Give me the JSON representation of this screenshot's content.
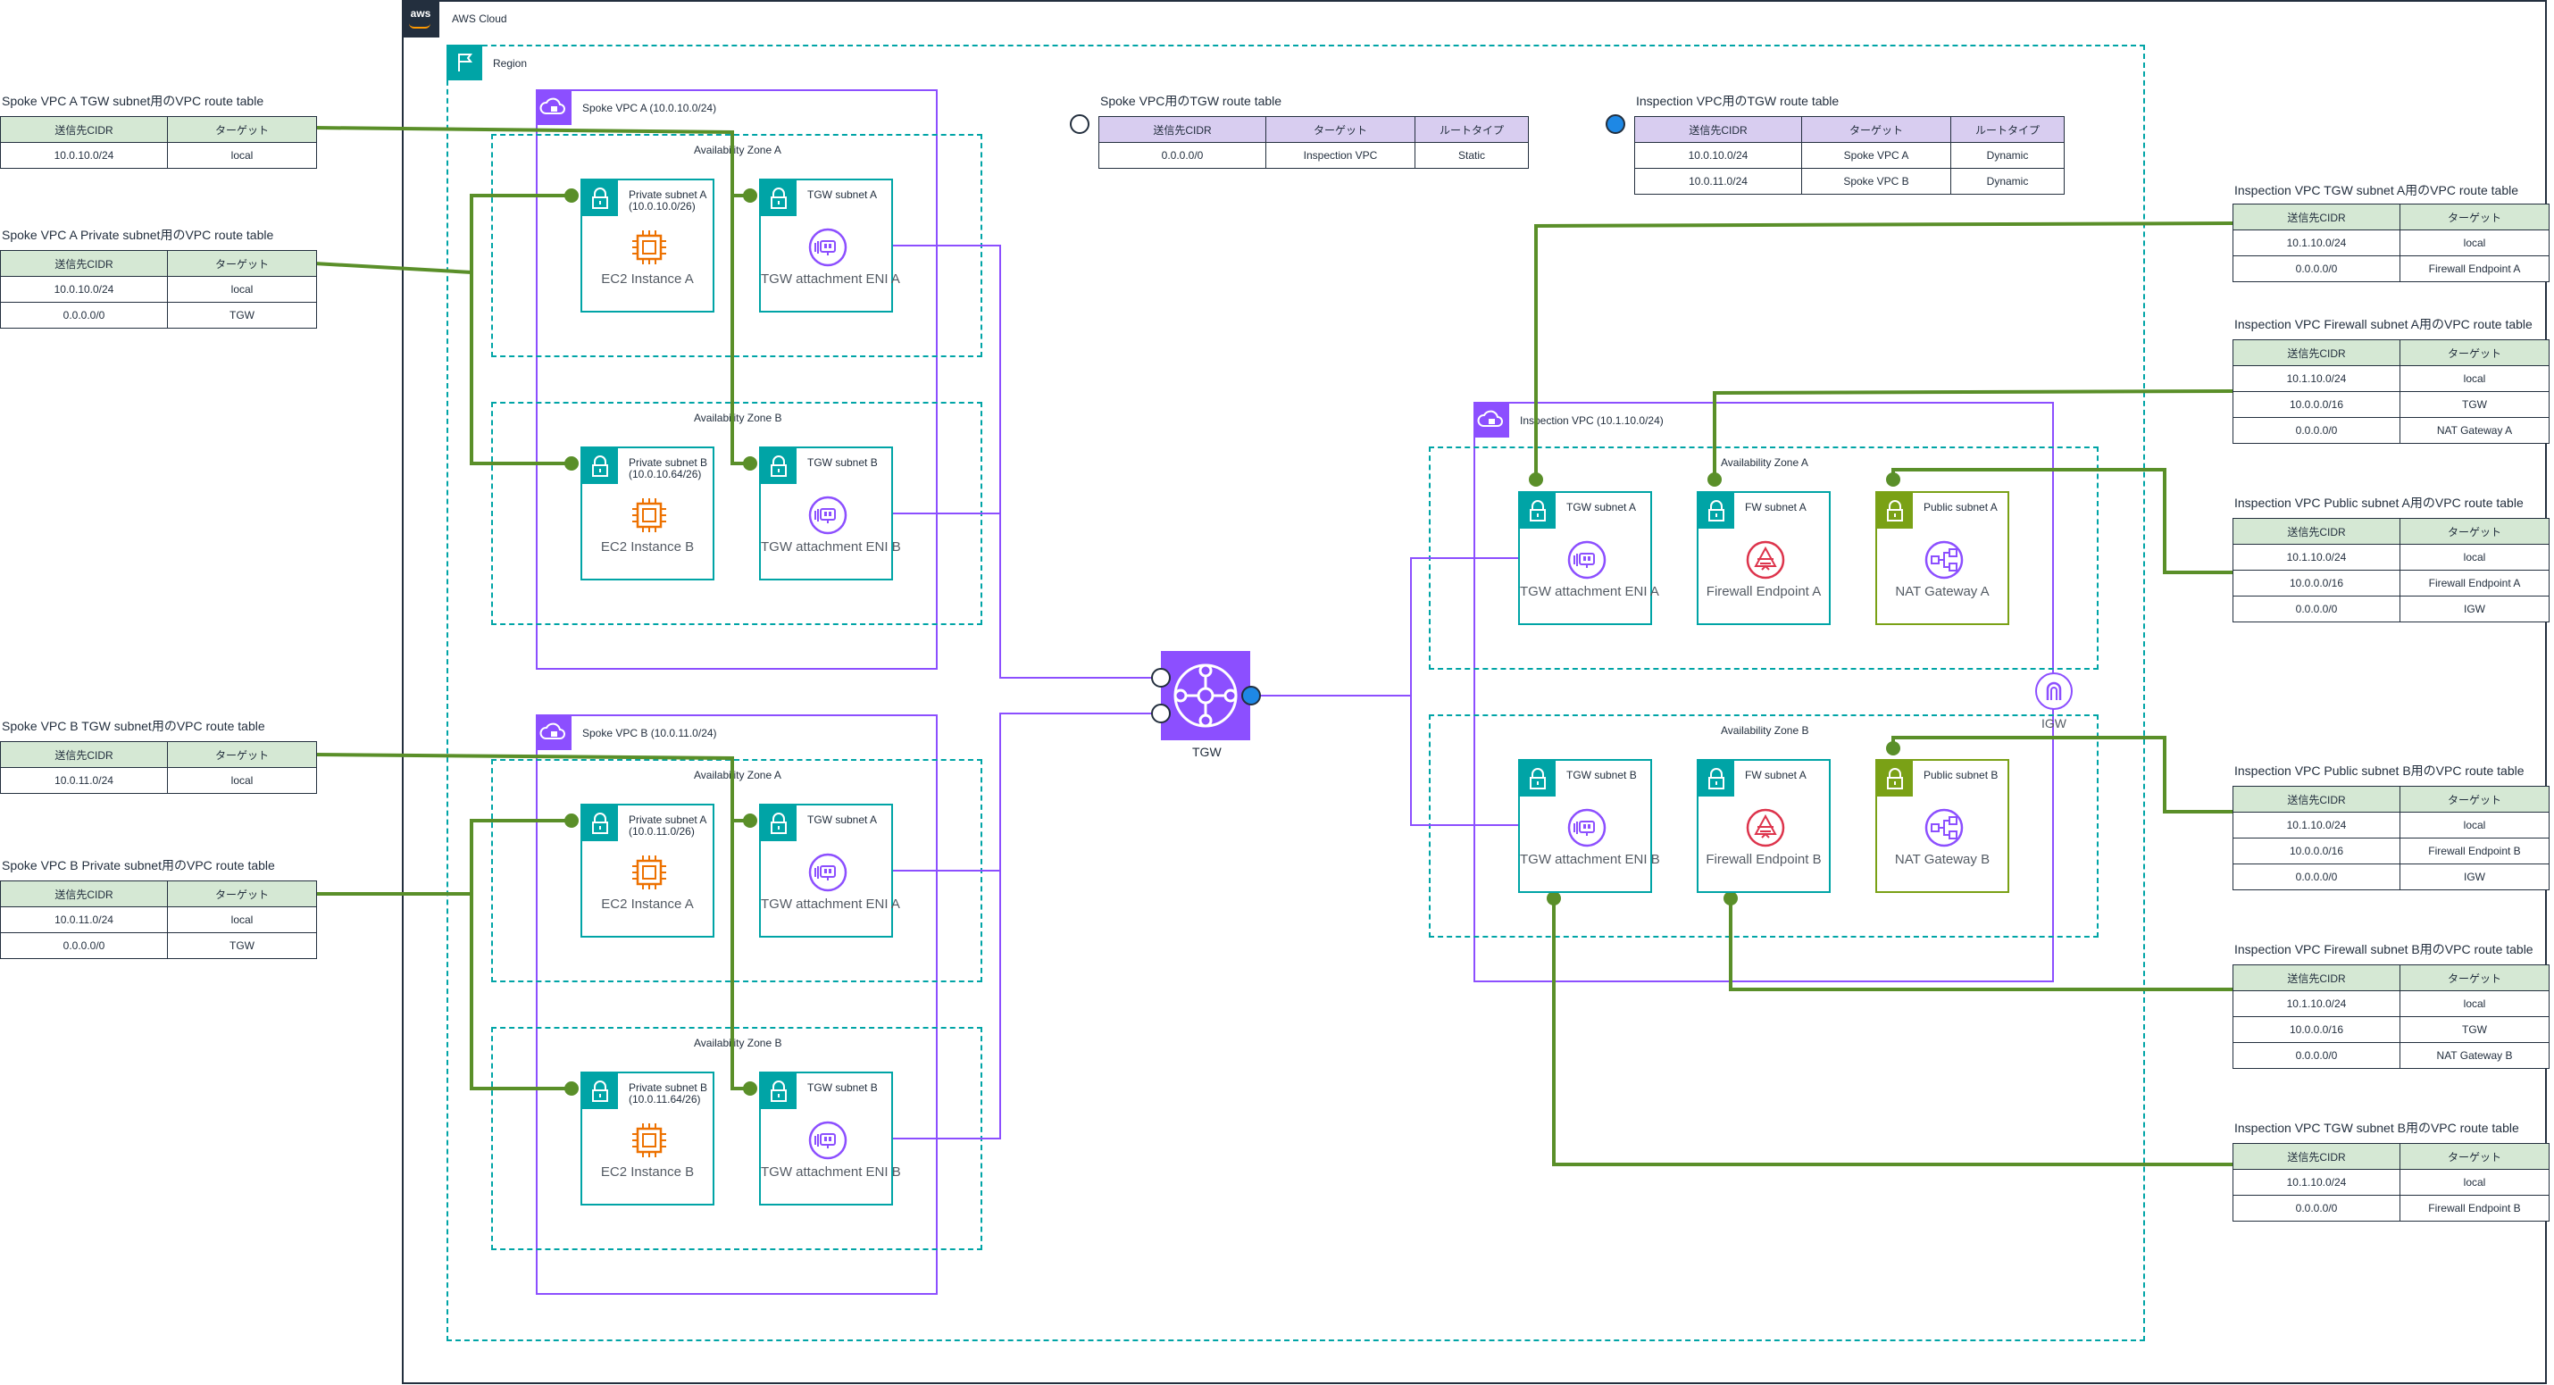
{
  "cloud_label": "AWS Cloud",
  "region_label": "Region",
  "spoke_a": {
    "vpc_label": "Spoke VPC A (10.0.10.0/24)",
    "az_a": "Availability Zone A",
    "az_b": "Availability Zone B",
    "priv_a": "Private subnet A\n(10.0.10.0/26)",
    "priv_b": "Private subnet B\n(10.0.10.64/26)",
    "tgw_sub_a": "TGW subnet A",
    "tgw_sub_b": "TGW subnet B",
    "ec2_a": "EC2 Instance A",
    "ec2_b": "EC2 Instance B",
    "eni_a": "TGW attachment ENI A",
    "eni_b": "TGW attachment ENI B"
  },
  "spoke_b": {
    "vpc_label": "Spoke VPC B (10.0.11.0/24)",
    "az_a": "Availability Zone A",
    "az_b": "Availability Zone B",
    "priv_a": "Private subnet A\n(10.0.11.0/26)",
    "priv_b": "Private subnet B\n(10.0.11.64/26)",
    "tgw_sub_a": "TGW subnet A",
    "tgw_sub_b": "TGW subnet B",
    "ec2_a": "EC2 Instance A",
    "ec2_b": "EC2 Instance B",
    "eni_a": "TGW attachment ENI A",
    "eni_b": "TGW attachment ENI B"
  },
  "inspection": {
    "vpc_label": "Inspection VPC (10.1.10.0/24)",
    "az_a": "Availability Zone A",
    "az_b": "Availability Zone B",
    "tgw_sub_a": "TGW subnet A",
    "tgw_sub_b": "TGW subnet B",
    "fw_sub_a": "FW subnet A",
    "fw_sub_b": "FW subnet A",
    "pub_sub_a": "Public subnet A",
    "pub_sub_b": "Public subnet B",
    "eni_a": "TGW attachment ENI A",
    "eni_b": "TGW attachment ENI B",
    "fw_a": "Firewall Endpoint A",
    "fw_b": "Firewall Endpoint B",
    "nat_a": "NAT Gateway A",
    "nat_b": "NAT Gateway B",
    "igw": "IGW"
  },
  "tgw_label": "TGW",
  "colors": {
    "green_line": "#5a8f29",
    "purple_line": "#8c4fff",
    "teal": "#00a4a6",
    "orange": "#ed7100",
    "red": "#dd344c",
    "nat_green": "#7aa116"
  },
  "tables": {
    "spoke_a_tgw": {
      "title": "Spoke VPC A TGW subnet用のVPC route table",
      "headers": [
        "送信先CIDR",
        "ターゲット"
      ],
      "rows": [
        [
          "10.0.10.0/24",
          "local"
        ]
      ]
    },
    "spoke_a_priv": {
      "title": "Spoke VPC A Private subnet用のVPC route table",
      "headers": [
        "送信先CIDR",
        "ターゲット"
      ],
      "rows": [
        [
          "10.0.10.0/24",
          "local"
        ],
        [
          "0.0.0.0/0",
          "TGW"
        ]
      ]
    },
    "spoke_b_tgw": {
      "title": "Spoke VPC B TGW subnet用のVPC route table",
      "headers": [
        "送信先CIDR",
        "ターゲット"
      ],
      "rows": [
        [
          "10.0.11.0/24",
          "local"
        ]
      ]
    },
    "spoke_b_priv": {
      "title": "Spoke VPC B Private subnet用のVPC route table",
      "headers": [
        "送信先CIDR",
        "ターゲット"
      ],
      "rows": [
        [
          "10.0.11.0/24",
          "local"
        ],
        [
          "0.0.0.0/0",
          "TGW"
        ]
      ]
    },
    "spoke_tgw_rt": {
      "title": "Spoke VPC用のTGW route table",
      "headers": [
        "送信先CIDR",
        "ターゲット",
        "ルートタイプ"
      ],
      "rows": [
        [
          "0.0.0.0/0",
          "Inspection VPC",
          "Static"
        ]
      ]
    },
    "insp_tgw_rt": {
      "title": "Inspection VPC用のTGW route table",
      "headers": [
        "送信先CIDR",
        "ターゲット",
        "ルートタイプ"
      ],
      "rows": [
        [
          "10.0.10.0/24",
          "Spoke VPC A",
          "Dynamic"
        ],
        [
          "10.0.11.0/24",
          "Spoke VPC B",
          "Dynamic"
        ]
      ]
    },
    "insp_tgw_a": {
      "title": "Inspection VPC TGW subnet A用のVPC route table",
      "headers": [
        "送信先CIDR",
        "ターゲット"
      ],
      "rows": [
        [
          "10.1.10.0/24",
          "local"
        ],
        [
          "0.0.0.0/0",
          "Firewall Endpoint A"
        ]
      ]
    },
    "insp_fw_a": {
      "title": "Inspection VPC Firewall subnet A用のVPC route table",
      "headers": [
        "送信先CIDR",
        "ターゲット"
      ],
      "rows": [
        [
          "10.1.10.0/24",
          "local"
        ],
        [
          "10.0.0.0/16",
          "TGW"
        ],
        [
          "0.0.0.0/0",
          "NAT Gateway A"
        ]
      ]
    },
    "insp_pub_a": {
      "title": "Inspection VPC Public subnet A用のVPC route table",
      "headers": [
        "送信先CIDR",
        "ターゲット"
      ],
      "rows": [
        [
          "10.1.10.0/24",
          "local"
        ],
        [
          "10.0.0.0/16",
          "Firewall Endpoint A"
        ],
        [
          "0.0.0.0/0",
          "IGW"
        ]
      ]
    },
    "insp_pub_b": {
      "title": "Inspection VPC Public subnet B用のVPC route table",
      "headers": [
        "送信先CIDR",
        "ターゲット"
      ],
      "rows": [
        [
          "10.1.10.0/24",
          "local"
        ],
        [
          "10.0.0.0/16",
          "Firewall Endpoint B"
        ],
        [
          "0.0.0.0/0",
          "IGW"
        ]
      ]
    },
    "insp_fw_b": {
      "title": "Inspection VPC Firewall subnet B用のVPC route table",
      "headers": [
        "送信先CIDR",
        "ターゲット"
      ],
      "rows": [
        [
          "10.1.10.0/24",
          "local"
        ],
        [
          "10.0.0.0/16",
          "TGW"
        ],
        [
          "0.0.0.0/0",
          "NAT Gateway B"
        ]
      ]
    },
    "insp_tgw_b": {
      "title": "Inspection VPC TGW subnet B用のVPC route table",
      "headers": [
        "送信先CIDR",
        "ターゲット"
      ],
      "rows": [
        [
          "10.1.10.0/24",
          "local"
        ],
        [
          "0.0.0.0/0",
          "Firewall Endpoint B"
        ]
      ]
    }
  }
}
